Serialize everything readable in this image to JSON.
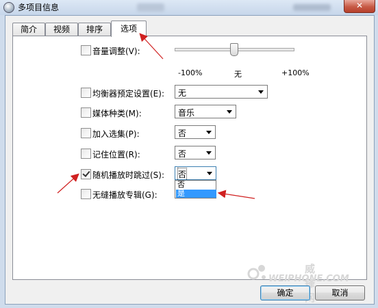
{
  "window": {
    "title": "多项目信息",
    "close_label": "✕"
  },
  "tabs": [
    {
      "label": "简介"
    },
    {
      "label": "视频"
    },
    {
      "label": "排序"
    },
    {
      "label": "选项"
    }
  ],
  "active_tab": "选项",
  "rows": {
    "volume": {
      "label": "音量调整(V):",
      "checked": false
    },
    "eq": {
      "label": "均衡器预定设置(E):",
      "value": "无",
      "checked": false
    },
    "media_kind": {
      "label": "媒体种类(M):",
      "value": "音乐",
      "checked": false
    },
    "compilation": {
      "label": "加入选集(P):",
      "value": "否",
      "checked": false
    },
    "remember_position": {
      "label": "记住位置(R):",
      "value": "否",
      "checked": false
    },
    "skip_shuffle": {
      "label": "随机播放时跳过(S):",
      "value": "否",
      "checked": true
    },
    "gapless": {
      "label": "无缝播放专辑(G):",
      "checked": false
    }
  },
  "volume_slider": {
    "min_label": "-100%",
    "mid_label": "无",
    "max_label": "+100%",
    "level": 0.5
  },
  "dropdown_options": [
    "否",
    "是"
  ],
  "dropdown_highlighted": "是",
  "buttons": {
    "ok": "确定",
    "cancel": "取消"
  },
  "watermark": {
    "cn": "威锋网",
    "en": "WEIPHONE.COM"
  },
  "colors": {
    "annotation_arrow": "#d02020",
    "selection_highlight": "#3399ff"
  }
}
